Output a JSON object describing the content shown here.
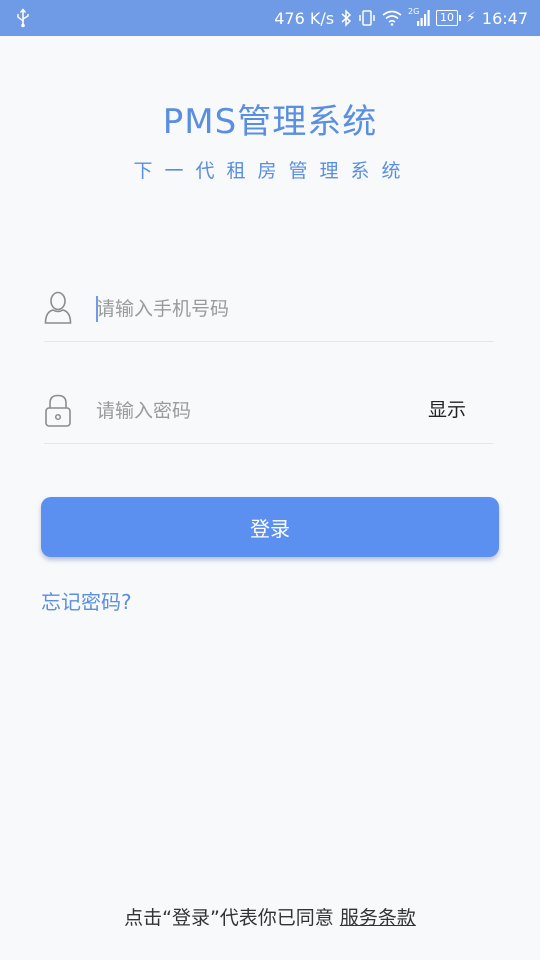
{
  "status_bar": {
    "net_speed": "476 K/s",
    "network_type": "2G",
    "battery_level": "10",
    "time": "16:47",
    "color": "#6f9be6"
  },
  "header": {
    "title": "PMS管理系统",
    "subtitle": "下一代租房管理系统"
  },
  "form": {
    "phone_placeholder": "请输入手机号码",
    "password_placeholder": "请输入密码",
    "show_password_label": "显示",
    "login_button_label": "登录",
    "forgot_password_label": "忘记密码?"
  },
  "footer": {
    "agreement_text": "点击“登录”代表你已同意",
    "terms_link": "服务条款"
  },
  "colors": {
    "accent": "#5b8ff0",
    "title": "#5a8ee0",
    "background": "#f8f9fb"
  },
  "icons": {
    "phone_field": "user-icon",
    "password_field": "lock-icon",
    "status": [
      "usb-icon",
      "bluetooth-icon",
      "vibrate-icon",
      "wifi-icon",
      "signal-icon",
      "battery-icon",
      "charging-icon"
    ]
  }
}
